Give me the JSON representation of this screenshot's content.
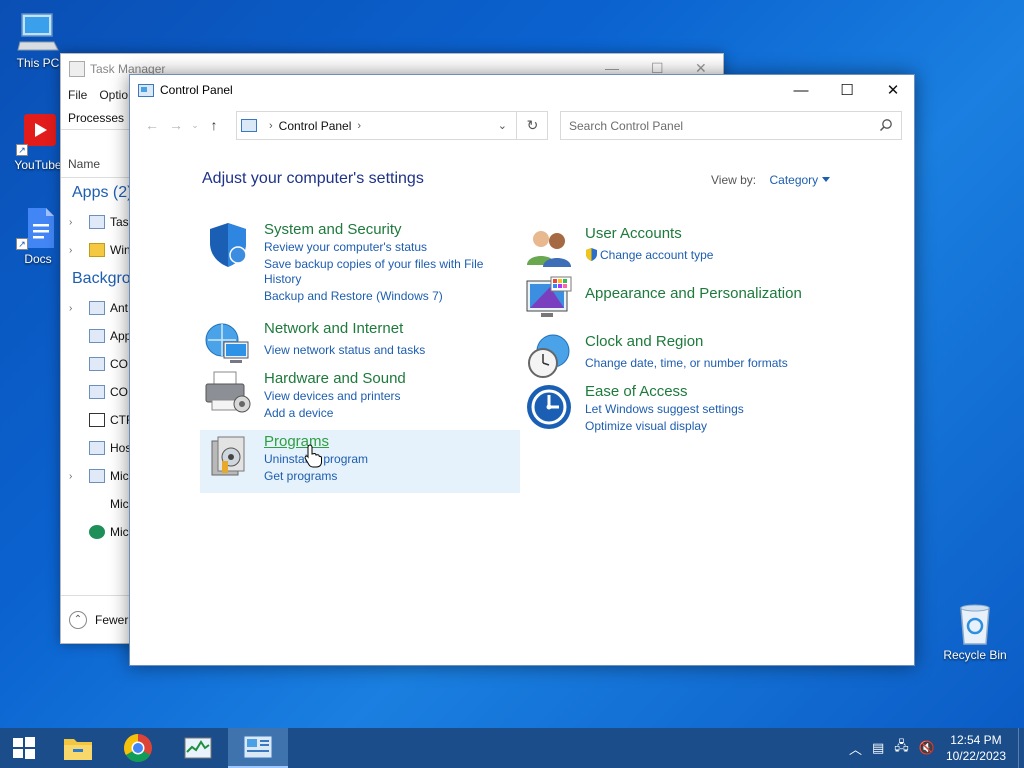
{
  "desktop": {
    "icons": [
      {
        "label": "This PC",
        "icon": "monitor-icon"
      },
      {
        "label": "YouTube",
        "icon": "youtube-icon"
      },
      {
        "label": "Docs",
        "icon": "docs-icon"
      },
      {
        "label": "Recycle Bin",
        "icon": "recycle-bin-icon"
      }
    ]
  },
  "task_manager": {
    "title": "Task Manager",
    "menu": [
      "File",
      "Optio"
    ],
    "tab": "Processes",
    "column_name": "Name",
    "group_apps": "Apps (2)",
    "group_background": "Backgrou",
    "rows": [
      "Task",
      "Win",
      "Ant",
      "App",
      "CO",
      "CO",
      "CTF",
      "Hos",
      "Mic",
      "Mic",
      "Mic"
    ],
    "fewer_details": "Fewer d"
  },
  "control_panel": {
    "title": "Control Panel",
    "address_path": "Control Panel",
    "search_placeholder": "Search Control Panel",
    "heading": "Adjust your computer's settings",
    "view_by_label": "View by:",
    "view_by_value": "Category",
    "categories_left": [
      {
        "title": "System and Security",
        "links": [
          "Review your computer's status",
          "Save backup copies of your files with File",
          "History",
          "Backup and Restore (Windows 7)"
        ]
      },
      {
        "title": "Network and Internet",
        "links": [
          "View network status and tasks"
        ]
      },
      {
        "title": "Hardware and Sound",
        "links": [
          "View devices and printers",
          "Add a device"
        ]
      },
      {
        "title": "Programs",
        "links": [
          "Uninstall a program",
          "Get programs"
        ]
      }
    ],
    "categories_right": [
      {
        "title": "User Accounts",
        "links": [
          "Change account type"
        ]
      },
      {
        "title": "Appearance and Personalization",
        "links": []
      },
      {
        "title": "Clock and Region",
        "links": [
          "Change date, time, or number formats"
        ]
      },
      {
        "title": "Ease of Access",
        "links": [
          "Let Windows suggest settings",
          "Optimize visual display"
        ]
      }
    ]
  },
  "taskbar": {
    "apps": [
      "start-icon",
      "file-explorer-icon",
      "chrome-icon",
      "task-manager-icon",
      "control-panel-icon"
    ],
    "time": "12:54 PM",
    "date": "10/22/2023"
  }
}
